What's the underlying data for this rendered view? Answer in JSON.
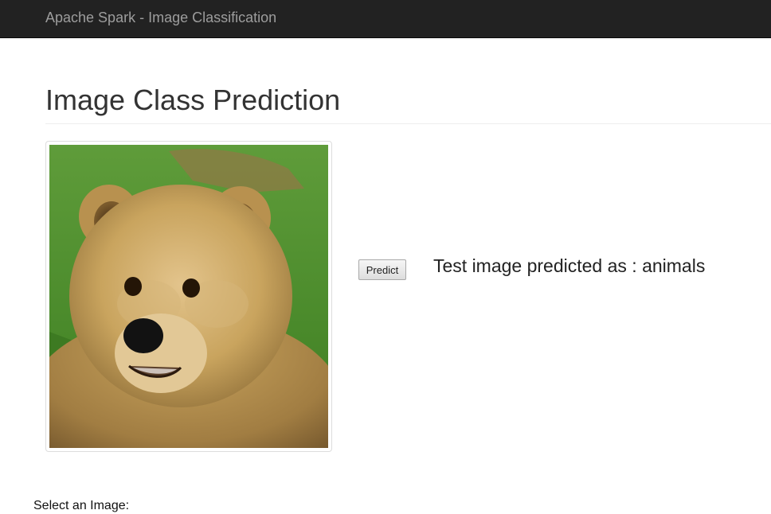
{
  "navbar": {
    "brand": "Apache Spark - Image Classification"
  },
  "page": {
    "title": "Image Class Prediction"
  },
  "image": {
    "subject": "brown bear on grass"
  },
  "controls": {
    "predict_label": "Predict",
    "result_text": "Test image predicted as : animals",
    "select_label": "Select an Image:"
  },
  "colors": {
    "navbar_bg": "#222222",
    "brand_text": "#9d9d9d",
    "grass": "#4f8d2e",
    "fur": "#c9a45e"
  }
}
